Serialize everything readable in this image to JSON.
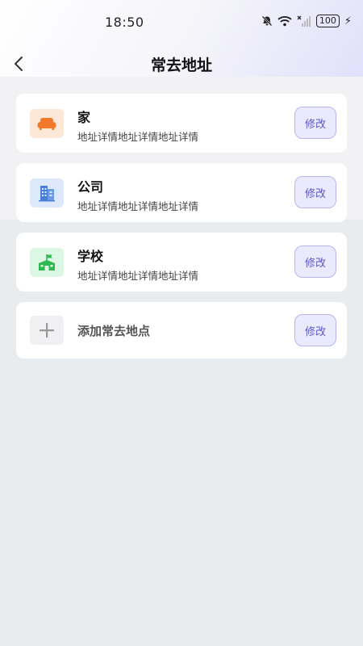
{
  "status_bar": {
    "time": "18:50",
    "battery": "100"
  },
  "header": {
    "title": "常去地址"
  },
  "addresses": [
    {
      "name": "家",
      "detail": "地址详情地址详情地址详情",
      "icon": "sofa-icon",
      "edit_label": "修改"
    },
    {
      "name": "公司",
      "detail": "地址详情地址详情地址详情",
      "icon": "building-icon",
      "edit_label": "修改"
    },
    {
      "name": "学校",
      "detail": "地址详情地址详情地址详情",
      "icon": "school-icon",
      "edit_label": "修改"
    }
  ],
  "add_item": {
    "label": "添加常去地点",
    "icon": "plus-icon",
    "edit_label": "修改"
  },
  "colors": {
    "accent": "#5a59c7",
    "home_icon": "#f07a2a",
    "company_icon": "#4a7fd8",
    "school_icon": "#2fb851"
  }
}
